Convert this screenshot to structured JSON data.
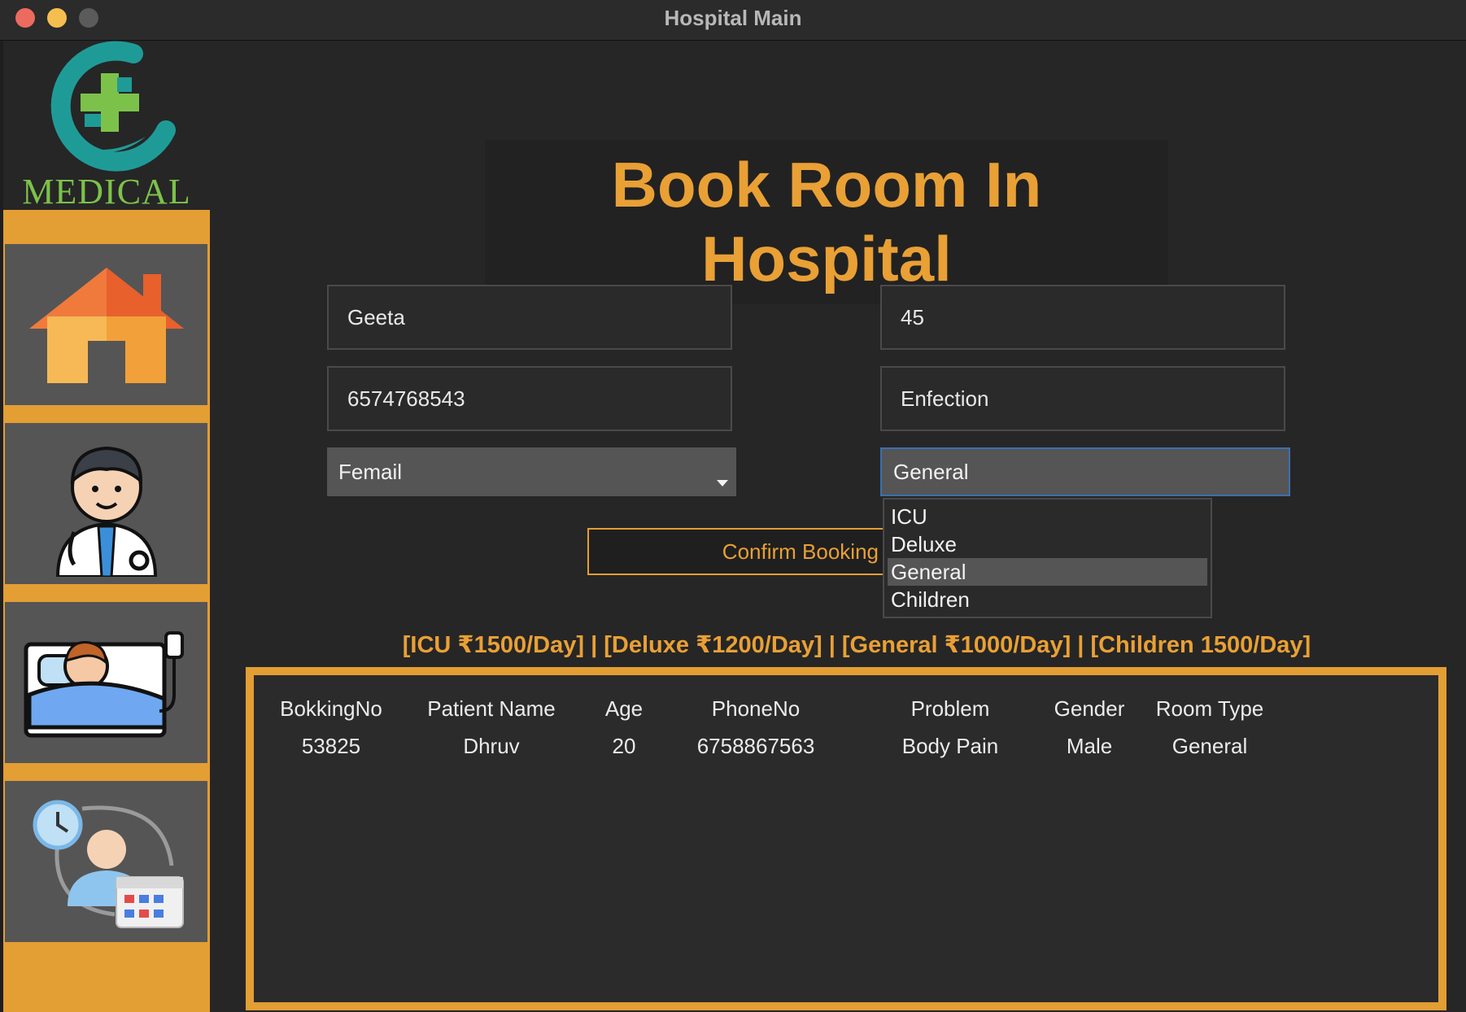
{
  "window": {
    "title": "Hospital Main"
  },
  "logo": {
    "text": "MEDICAL"
  },
  "sidebar": {
    "items": [
      {
        "name": "home",
        "icon": "house-icon"
      },
      {
        "name": "doctor",
        "icon": "doctor-icon"
      },
      {
        "name": "patient-bed",
        "icon": "hospital-bed-icon"
      },
      {
        "name": "appointment",
        "icon": "appointment-schedule-icon"
      }
    ]
  },
  "page": {
    "title": "Book Room In Hospital"
  },
  "form": {
    "name_value": "Geeta",
    "age_value": "45",
    "phone_value": "6574768543",
    "problem_value": "Enfection",
    "gender_value": "Femail",
    "room_type_value": "General",
    "room_type_options": [
      "ICU",
      "Deluxe",
      "General",
      "Children"
    ],
    "confirm_label": "Confirm Booking"
  },
  "pricing": {
    "text": "[ICU ₹1500/Day] | [Deluxe ₹1200/Day] | [General ₹1000/Day] | [Children 1500/Day]"
  },
  "table": {
    "headers": [
      "BokkingNo",
      "Patient Name",
      "Age",
      "PhoneNo",
      "Problem",
      "Gender",
      "Room Type"
    ],
    "rows": [
      [
        "53825",
        "Dhruv",
        "20",
        "6758867563",
        "Body Pain",
        "Male",
        "General"
      ]
    ]
  },
  "colors": {
    "accent": "#e39e34",
    "background": "#262626",
    "sidebar_button": "#555555"
  }
}
